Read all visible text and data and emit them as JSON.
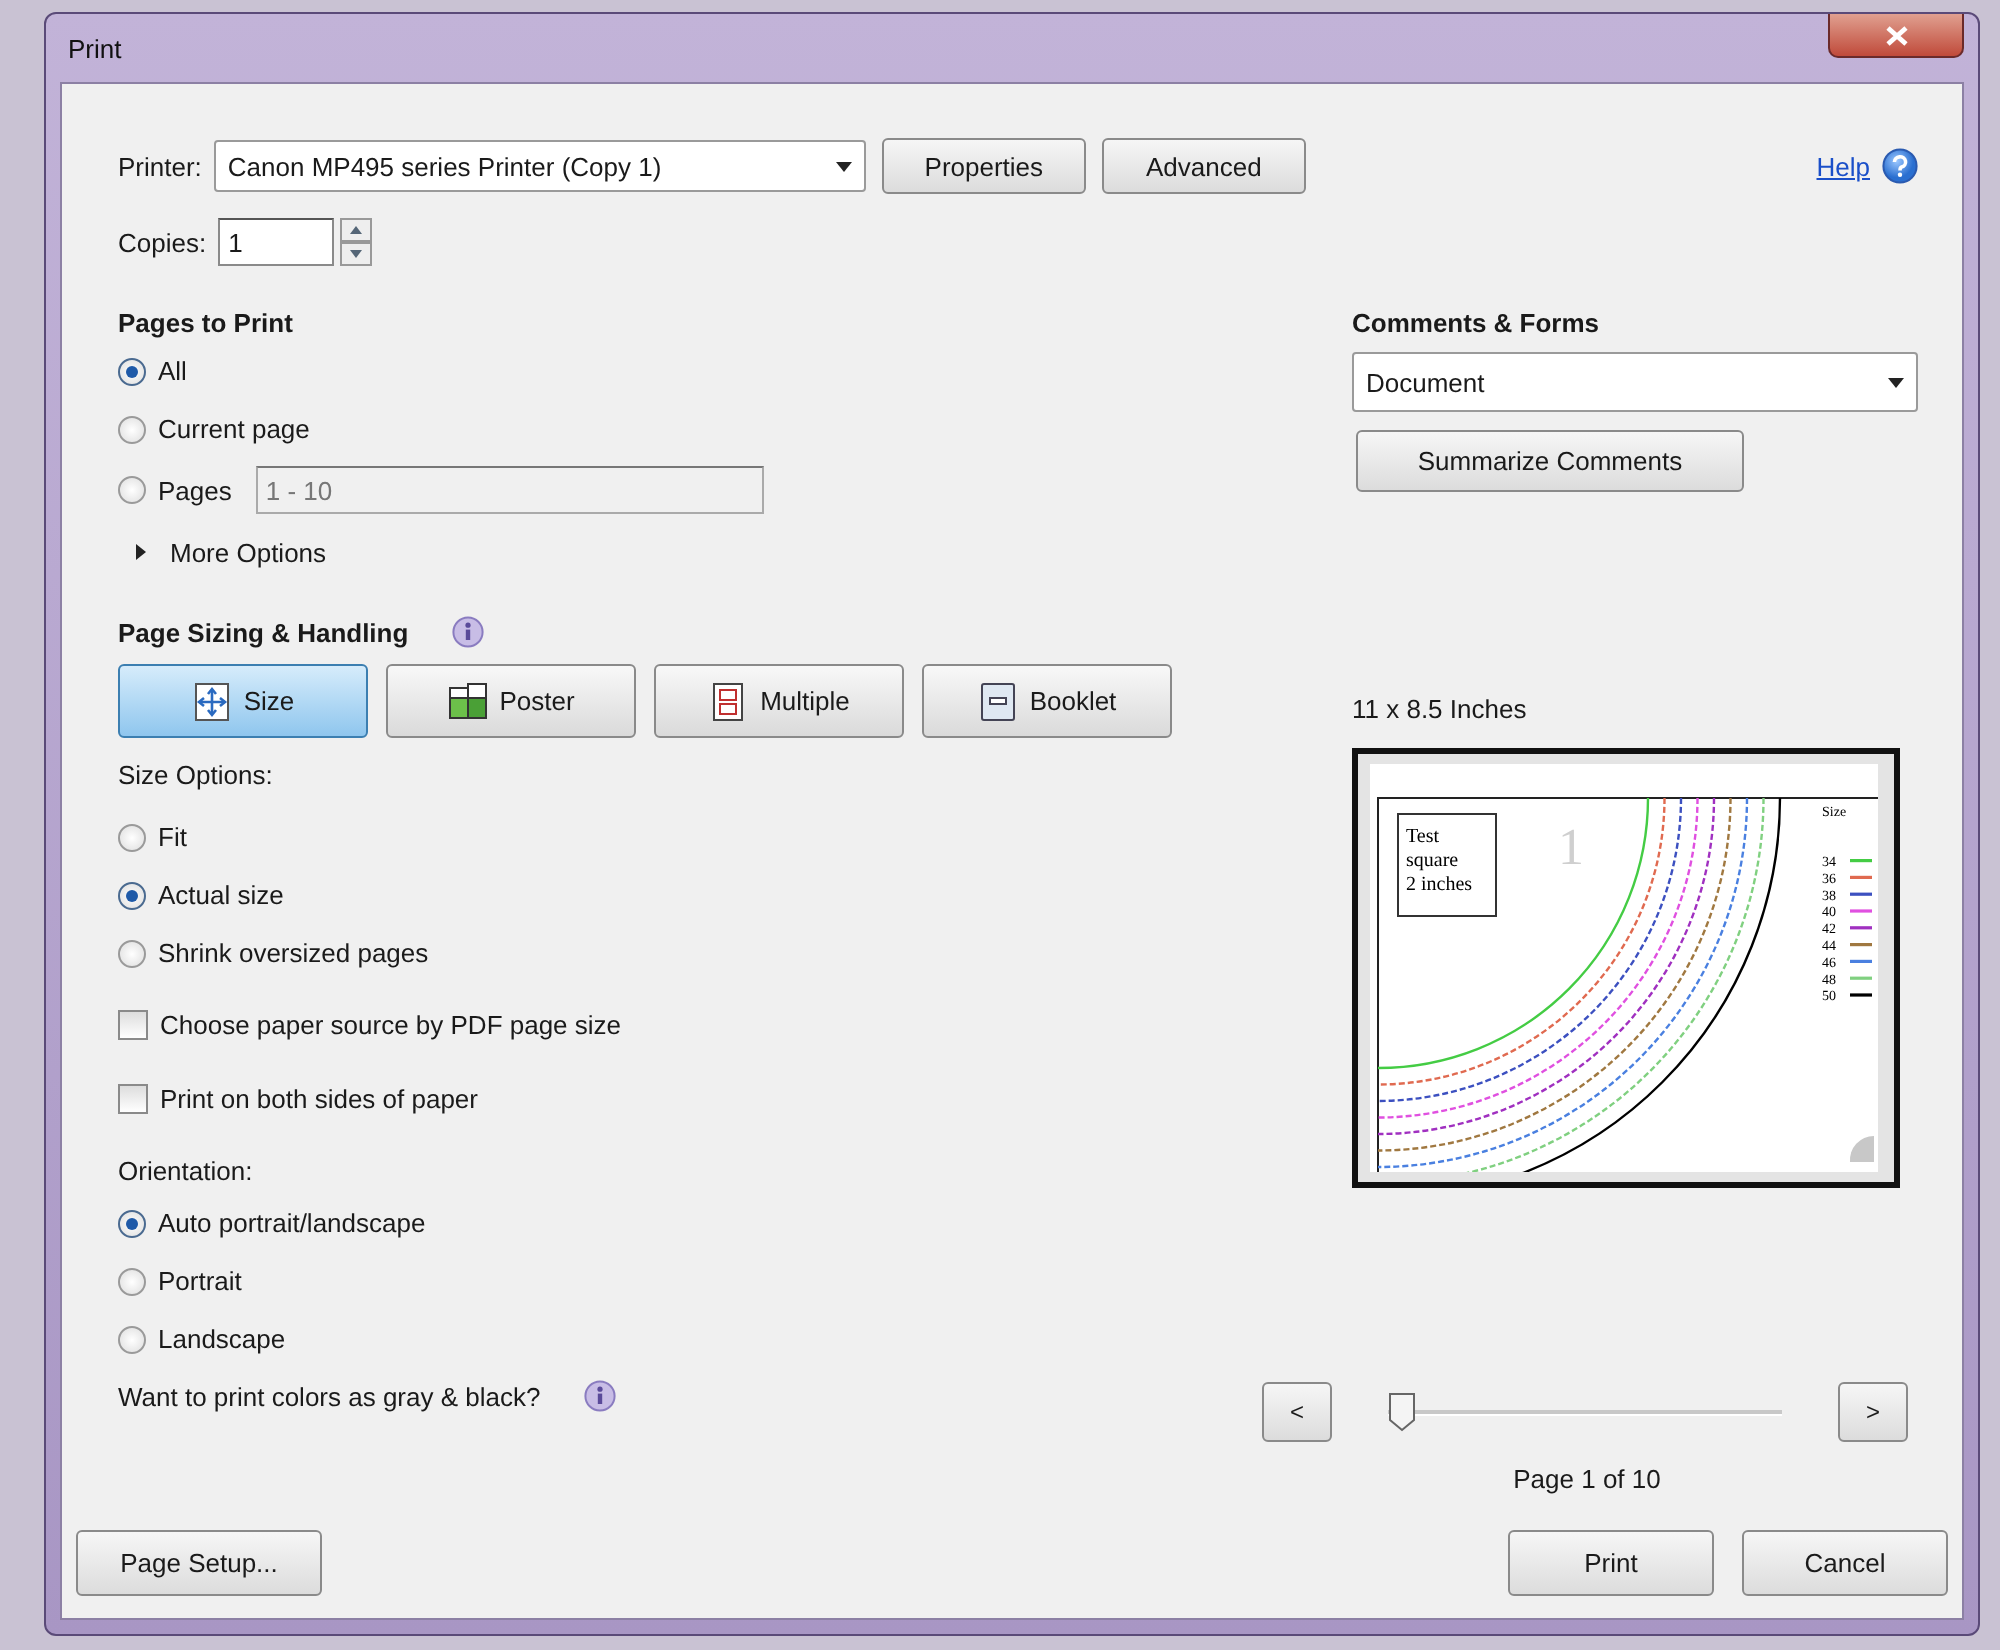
{
  "window": {
    "title": "Print"
  },
  "printer": {
    "label": "Printer:",
    "value": "Canon MP495 series Printer (Copy 1)",
    "buttons": [
      "Properties",
      "Advanced"
    ],
    "help": "Help"
  },
  "copies": {
    "label": "Copies:",
    "value": "1"
  },
  "pages_to_print": {
    "heading": "Pages to Print",
    "options": [
      {
        "label": "All",
        "selected": true
      },
      {
        "label": "Current page",
        "selected": false
      },
      {
        "label": "Pages",
        "selected": false,
        "field": {
          "value": "1 - 10",
          "disabled": true
        }
      }
    ],
    "more_options": {
      "label": "More Options",
      "expanded": false
    }
  },
  "page_sizing": {
    "heading": "Page Sizing & Handling",
    "modes": [
      {
        "label": "Size",
        "kind": "size",
        "selected": true
      },
      {
        "label": "Poster",
        "kind": "poster",
        "selected": false
      },
      {
        "label": "Multiple",
        "kind": "multiple",
        "selected": false
      },
      {
        "label": "Booklet",
        "kind": "booklet",
        "selected": false
      }
    ],
    "size_options": {
      "heading": "Size Options:",
      "options": [
        {
          "label": "Fit",
          "selected": false
        },
        {
          "label": "Actual size",
          "selected": true
        },
        {
          "label": "Shrink oversized pages",
          "selected": false
        }
      ]
    },
    "checkboxes": [
      {
        "label": "Choose paper source by PDF page size",
        "checked": false
      },
      {
        "label": "Print on both sides of paper",
        "checked": false
      }
    ],
    "orientation": {
      "heading": "Orientation:",
      "options": [
        {
          "label": "Auto portrait/landscape",
          "selected": true
        },
        {
          "label": "Portrait",
          "selected": false
        },
        {
          "label": "Landscape",
          "selected": false
        }
      ]
    },
    "grayscale_question": "Want to print colors as gray & black?"
  },
  "comments_forms": {
    "heading": "Comments & Forms",
    "value": "Document",
    "button": "Summarize Comments"
  },
  "preview": {
    "size_label": "11 x 8.5 Inches",
    "page": {
      "test_square": [
        "Test",
        "square",
        "2 inches"
      ],
      "page_number": "1",
      "legend_title": "Size",
      "legend": [
        {
          "label": "34",
          "color": "#44cc44"
        },
        {
          "label": "36",
          "color": "#e06a50"
        },
        {
          "label": "38",
          "color": "#3c50c0"
        },
        {
          "label": "40",
          "color": "#e050e0"
        },
        {
          "label": "42",
          "color": "#a030c0"
        },
        {
          "label": "44",
          "color": "#a07840"
        },
        {
          "label": "46",
          "color": "#4a80e0"
        },
        {
          "label": "48",
          "color": "#80d080"
        },
        {
          "label": "50",
          "color": "#000000"
        }
      ]
    }
  },
  "navigation": {
    "prev": "<",
    "next": ">",
    "level": 0,
    "page_label": "Page 1 of 10"
  },
  "footer": {
    "page_setup": "Page Setup...",
    "print": "Print",
    "cancel": "Cancel"
  }
}
